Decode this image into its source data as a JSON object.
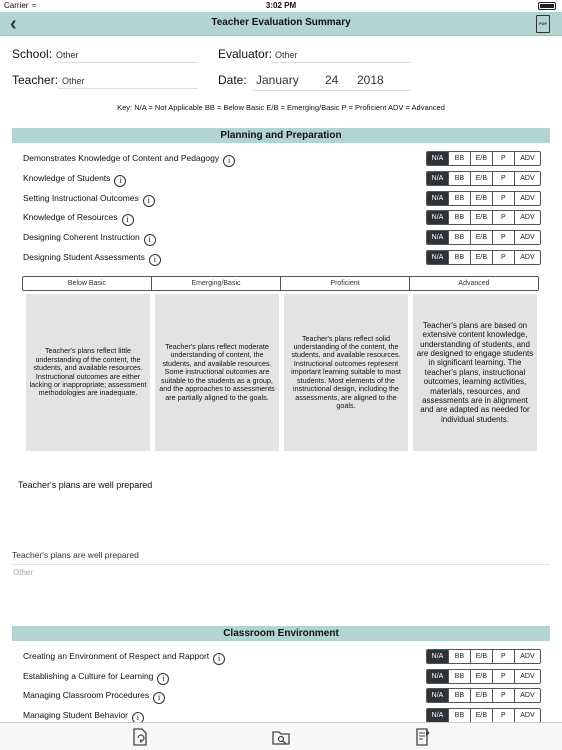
{
  "status": {
    "carrier": "Carrier",
    "time": "3:02 PM"
  },
  "nav": {
    "title": "Teacher Evaluation Summary",
    "pdf_label": "PDF"
  },
  "form": {
    "school_label": "School:",
    "school_value": "Other",
    "evaluator_label": "Evaluator:",
    "evaluator_value": "Other",
    "teacher_label": "Teacher:",
    "teacher_value": "Other",
    "date_label": "Date:",
    "date_month": "January",
    "date_day": "24",
    "date_year": "2018"
  },
  "key": "Key:  N/A = Not Applicable      BB = Below Basic      E/B = Emerging/Basic      P = Proficient      ADV = Advanced",
  "rating_options": [
    "N/A",
    "BB",
    "E/B",
    "P",
    "ADV"
  ],
  "sections": [
    {
      "title": "Planning and Preparation",
      "criteria": [
        {
          "label": "Demonstrates Knowledge of Content and Pedagogy",
          "selected": "N/A"
        },
        {
          "label": "Knowledge of Students",
          "selected": "N/A"
        },
        {
          "label": "Setting Instructional Outcomes",
          "selected": "N/A"
        },
        {
          "label": "Knowledge of Resources",
          "selected": "N/A"
        },
        {
          "label": "Designing Coherent Instruction",
          "selected": "N/A"
        },
        {
          "label": "Designing Student Assessments",
          "selected": "N/A"
        }
      ]
    },
    {
      "title": "Classroom Environment",
      "criteria": [
        {
          "label": "Creating an Environment of Respect and Rapport",
          "selected": "N/A"
        },
        {
          "label": "Establishing a Culture for Learning",
          "selected": "N/A"
        },
        {
          "label": "Managing Classroom Procedures",
          "selected": "N/A"
        },
        {
          "label": "Managing Student Behavior",
          "selected": "N/A"
        }
      ]
    }
  ],
  "rubric": {
    "headers": [
      "Below Basic",
      "Emerging/Basic",
      "Proficient",
      "Advanced"
    ],
    "descriptions": [
      "Teacher's plans reflect little understanding of the content, the students, and available resources. Instructional outcomes are either lacking or inappropriate; assessment methodologies are inadequate.",
      "Teacher's plans reflect moderate understanding of content, the students, and available resources. Some instructional outcomes are suitable to the students as a group, and the approaches to assessments are partially aligned to the goals.",
      "Teacher's plans reflect solid understanding of the content, the students, and available resources. Instructional outcomes represent important learning suitable to most students. Most elements of the instructional design, including the assessments, are aligned to the goals.",
      "Teacher's plans are based on extensive content knowledge, understanding of students, and are designed to engage students in significant learning. The teacher's plans, instructional outcomes, learning activities, materials, resources, and assessments are in alignment and are adapted as needed for individual students."
    ]
  },
  "comments": {
    "main": "Teacher's plans are well prepared",
    "secondary": "Teacher's plans are well prepared",
    "placeholder": "Other"
  }
}
